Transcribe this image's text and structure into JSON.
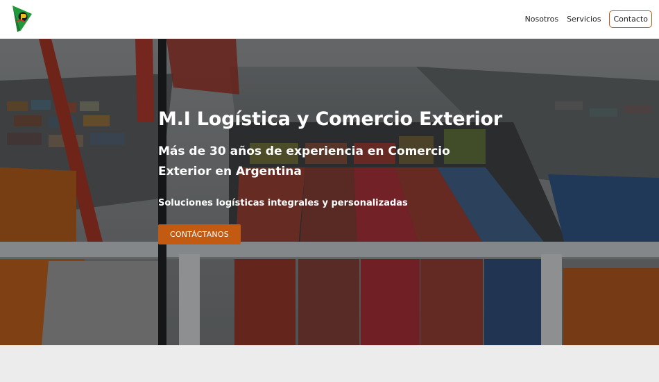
{
  "header": {
    "nav": {
      "nosotros": "Nosotros",
      "servicios": "Servicios",
      "contacto": "Contacto"
    }
  },
  "hero": {
    "title": "M.I Logística y Comercio Exterior",
    "subtitle": "Más de 30 años de experiencia en Comercio Exterior en Argentina",
    "tagline": "Soluciones logísticas integrales y personalizadas",
    "cta_label": "CONTÁCTANOS"
  },
  "colors": {
    "accent": "#c35a12",
    "logo_green": "#1f9a3a",
    "header_bg": "#ffffff",
    "footer_bg": "#ececec"
  }
}
